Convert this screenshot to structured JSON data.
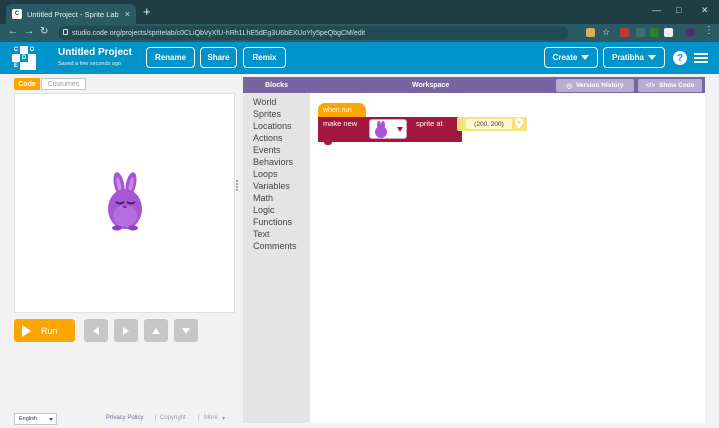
{
  "browser": {
    "tab_title": "Untitled Project - Sprite Lab",
    "url": "studio.code.org/projects/spritelab/c0CLiQbVyXfU-hRh1LhE5dEg3U6bEXUoYly5peQbgCM/edit",
    "new_tab": "+",
    "tab_close": "×",
    "back": "←",
    "forward": "→",
    "reload": "C"
  },
  "header": {
    "logo_letters": [
      "C",
      "O",
      "D",
      "E"
    ],
    "project_title": "Untitled Project",
    "saved_status": "Saved a few seconds ago",
    "rename_label": "Rename",
    "share_label": "Share",
    "remix_label": "Remix",
    "create_label": "Create",
    "user_label": "Pratibha",
    "help_label": "?"
  },
  "left": {
    "code_tab": "Code",
    "costumes_tab": "Costumes",
    "run_label": "Run",
    "language": "English",
    "privacy_label": "Privacy Policy",
    "copyright_label": "Copyright",
    "more_label": "More",
    "footer_sep": "|",
    "more_caret": "▾"
  },
  "workspace": {
    "blocks_label": "Blocks",
    "workspace_label": "Workspace",
    "version_history_label": "Version History",
    "show_code_label": "Show Code",
    "categories": [
      "World",
      "Sprites",
      "Locations",
      "Actions",
      "Events",
      "Behaviors",
      "Loops",
      "Variables",
      "Math",
      "Logic",
      "Functions",
      "Text",
      "Comments"
    ]
  },
  "blocks": {
    "hat_label": "when run",
    "make_new_label": "make new",
    "sprite_at_label": "sprite at",
    "location_value": "(200, 200)"
  },
  "colors": {
    "codeorg_blue": "#0094ca",
    "run_orange": "#ffa400",
    "workspace_purple": "#7665a0",
    "sprite_block": "#a3173f",
    "location_yellow": "#f8e27c",
    "bunny_purple": "#a655d6"
  }
}
